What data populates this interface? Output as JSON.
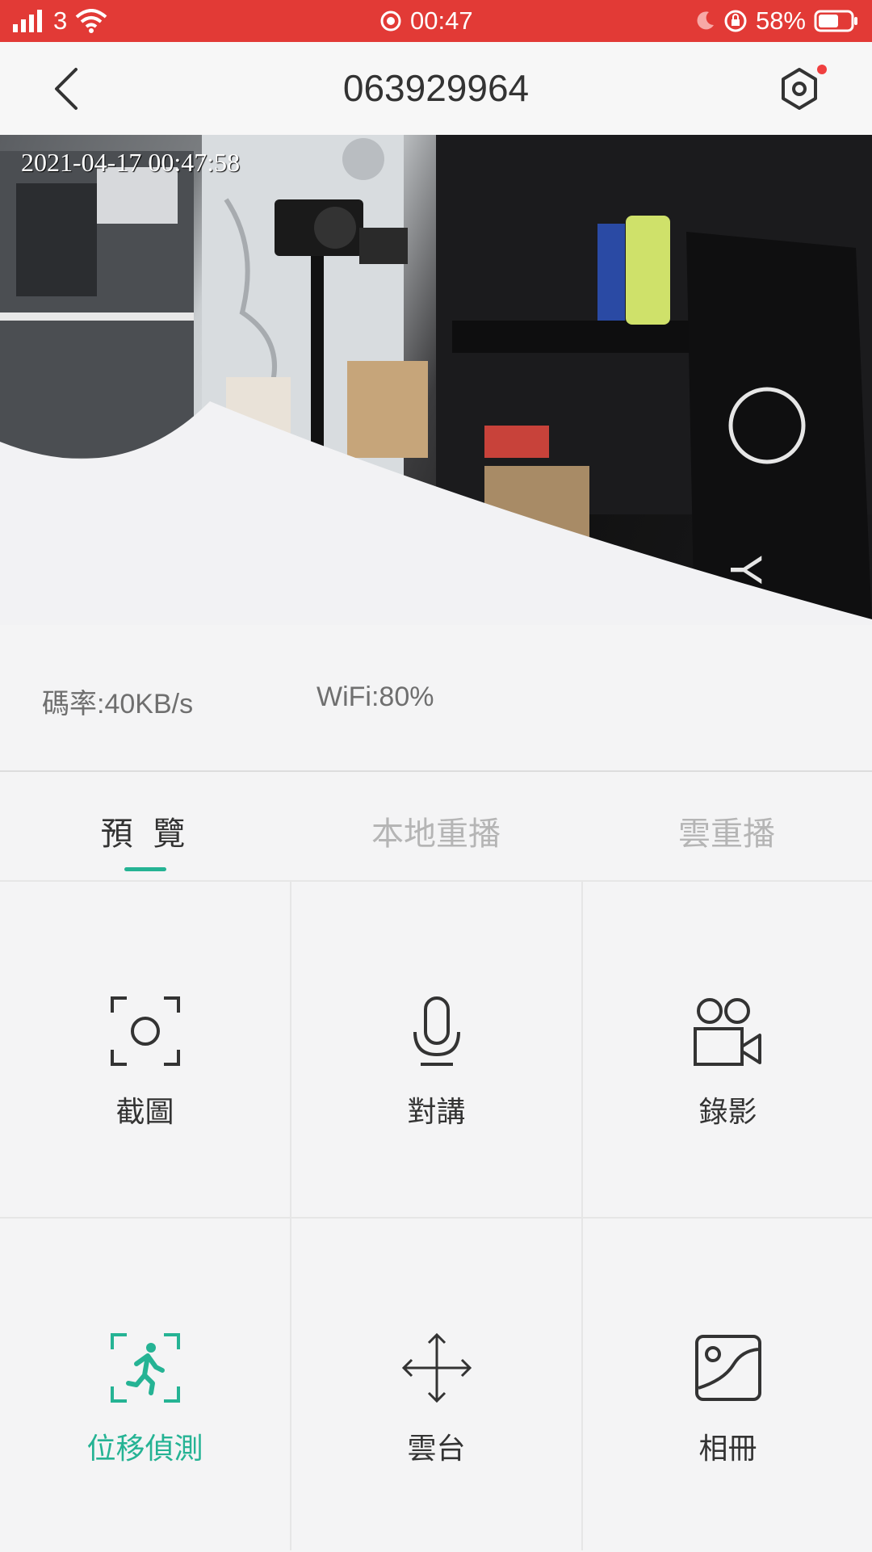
{
  "status_bar": {
    "carrier": "3",
    "time": "00:47",
    "battery": "58%",
    "bg_color": "#e23a36"
  },
  "header": {
    "title": "063929964",
    "back_icon": "chevron-left-icon",
    "settings_icon": "hexagon-gear-icon",
    "has_notification_dot": true
  },
  "video": {
    "timestamp": "2021-04-17 00:47:58"
  },
  "stats": {
    "bitrate": "碼率:40KB/s",
    "wifi": "WiFi:80%"
  },
  "tabs": [
    {
      "label": "預 覽",
      "active": true
    },
    {
      "label": "本地重播",
      "active": false
    },
    {
      "label": "雲重播",
      "active": false
    }
  ],
  "actions": [
    {
      "label": "截圖",
      "icon": "screenshot-icon"
    },
    {
      "label": "對講",
      "icon": "microphone-icon"
    },
    {
      "label": "錄影",
      "icon": "video-camera-icon"
    },
    {
      "label": "位移偵測",
      "icon": "motion-detect-icon",
      "highlighted": true
    },
    {
      "label": "雲台",
      "icon": "move-arrows-icon"
    },
    {
      "label": "相冊",
      "icon": "album-icon"
    }
  ],
  "accent_color": "#25b394"
}
